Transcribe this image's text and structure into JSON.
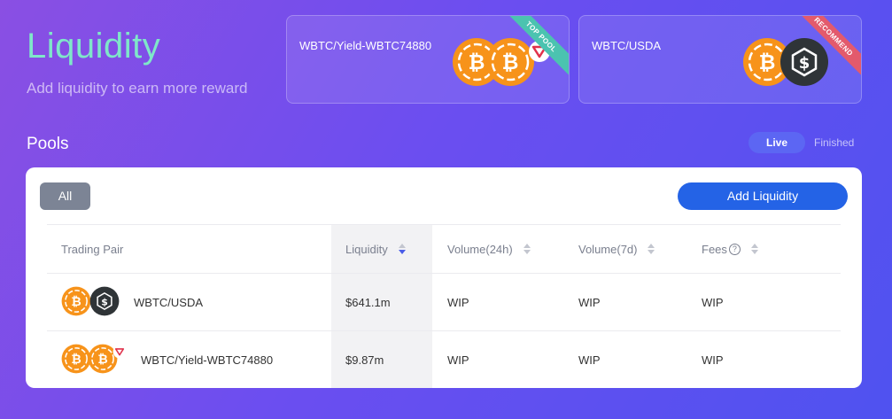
{
  "hero": {
    "title": "Liquidity",
    "subtitle": "Add liquidity to earn more reward"
  },
  "featured": [
    {
      "pair": "WBTC/Yield-WBTC74880",
      "ribbon": "TOP POOL",
      "ribbon_color": "#4bc3b0",
      "icons": [
        "bitcoin-icon",
        "bitcoin-icon",
        "yield-token-icon"
      ]
    },
    {
      "pair": "WBTC/USDA",
      "ribbon": "RECOMMEND",
      "ribbon_color": "#e35a6c",
      "icons": [
        "bitcoin-icon",
        "usda-icon"
      ]
    }
  ],
  "pools": {
    "title": "Pools",
    "tabs": {
      "live": "Live",
      "finished": "Finished"
    },
    "filter_all": "All",
    "add_liquidity": "Add Liquidity",
    "columns": {
      "trading_pair": "Trading Pair",
      "liquidity": "Liquidity",
      "volume24h": "Volume(24h)",
      "volume7d": "Volume(7d)",
      "fees": "Fees",
      "fees_help": "?"
    },
    "rows": [
      {
        "pair": "WBTC/USDA",
        "liquidity": "$641.1m",
        "volume24h": "WIP",
        "volume7d": "WIP",
        "fees": "WIP"
      },
      {
        "pair": "WBTC/Yield-WBTC74880",
        "liquidity": "$9.87m",
        "volume24h": "WIP",
        "volume7d": "WIP",
        "fees": "WIP"
      }
    ]
  },
  "colors": {
    "accent": "#2463e6",
    "title": "#7fe7c9",
    "bitcoin": "#f7931a",
    "usda": "#2f3437",
    "yield": "#e0314b"
  }
}
